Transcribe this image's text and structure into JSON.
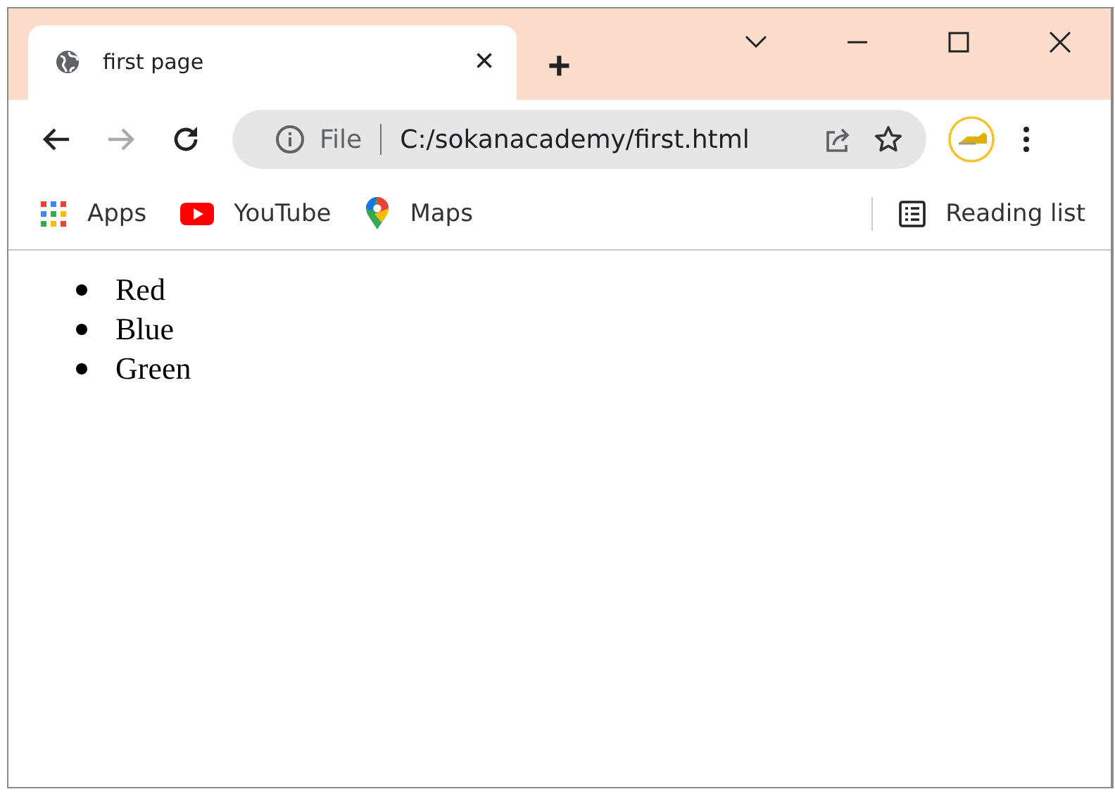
{
  "window": {
    "controls": [
      {
        "kind": "chevron"
      },
      {
        "kind": "minimize"
      },
      {
        "kind": "maximize"
      },
      {
        "kind": "close"
      }
    ]
  },
  "tabs": [
    {
      "title": "first page",
      "close": "×",
      "selected": true
    }
  ],
  "new_tab": "+",
  "toolbar": {
    "back_enabled": true,
    "forward_enabled": false,
    "address": {
      "scheme_label": "File",
      "url": "C:/sokanacademy/first.html"
    }
  },
  "bookmarks": [
    {
      "label": "Apps",
      "kind": "apps"
    },
    {
      "label": "YouTube",
      "kind": "youtube"
    },
    {
      "label": "Maps",
      "kind": "maps"
    }
  ],
  "reading_list": "Reading list",
  "content": {
    "list_items": [
      "Red",
      "Blue",
      "Green"
    ]
  }
}
